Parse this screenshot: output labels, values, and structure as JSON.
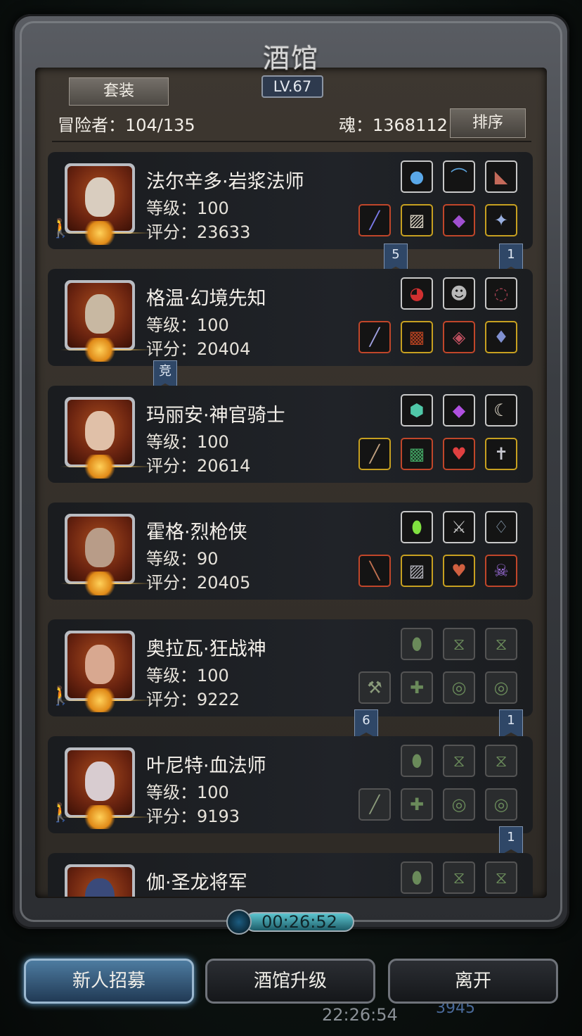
{
  "header": {
    "title": "酒馆",
    "level": "LV.67",
    "suit_button": "套装",
    "adventurers": "冒险者：104/135",
    "soul": "魂：1368112",
    "sort_button": "排序"
  },
  "heroes": [
    {
      "name": "法尔辛多·岩浆法师",
      "level": "等级：100",
      "score": "评分：23633"
    },
    {
      "name": "格温·幻境先知",
      "level": "等级：100",
      "score": "评分：20404"
    },
    {
      "name": "玛丽安·神官骑士",
      "level": "等级：100",
      "score": "评分：20614"
    },
    {
      "name": "霍格·烈枪侠",
      "level": "等级：90",
      "score": "评分：20405"
    },
    {
      "name": "奥拉瓦·狂战神",
      "level": "等级：100",
      "score": "评分：9222"
    },
    {
      "name": "叶尼特·血法师",
      "level": "等级：100",
      "score": "评分：9193"
    },
    {
      "name": "伽·圣龙将军",
      "level": "",
      "score": ""
    }
  ],
  "flags": {
    "f1a": "5",
    "f1b": "1",
    "f2a": "竞",
    "f5a": "6",
    "f5b": "1",
    "f6b": "1"
  },
  "timer": "00:26:52",
  "buttons": {
    "recruit": "新人招募",
    "upgrade": "酒馆升级",
    "leave": "离开"
  },
  "background": {
    "time": "22:26:54",
    "currency": "3945"
  }
}
